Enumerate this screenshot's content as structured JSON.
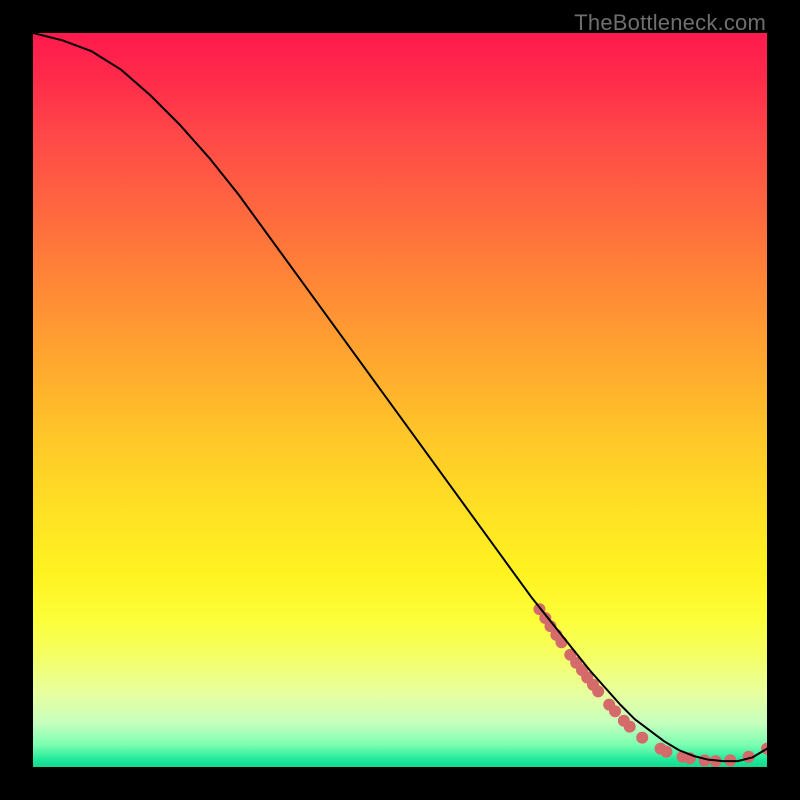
{
  "watermark": "TheBottleneck.com",
  "colors": {
    "background": "#000000",
    "curve": "#000000",
    "marker": "#d46a6a",
    "gradient_top": "#ff1a4d",
    "gradient_mid": "#fff321",
    "gradient_bottom": "#15d890"
  },
  "chart_data": {
    "type": "line",
    "title": "",
    "xlabel": "",
    "ylabel": "",
    "xlim": [
      0,
      100
    ],
    "ylim": [
      0,
      100
    ],
    "grid": false,
    "legend": false,
    "series": [
      {
        "name": "curve",
        "x": [
          0,
          4,
          8,
          12,
          16,
          20,
          24,
          28,
          32,
          36,
          40,
          44,
          48,
          52,
          56,
          60,
          64,
          68,
          72,
          76,
          80,
          82,
          84,
          86,
          88,
          90,
          92,
          94,
          96,
          98,
          100
        ],
        "y": [
          100,
          99,
          97.5,
          95,
          91.5,
          87.5,
          83,
          78,
          72.5,
          67,
          61.5,
          56,
          50.5,
          45,
          39.5,
          34,
          28.5,
          23,
          18,
          13,
          8.5,
          6.5,
          5,
          3.5,
          2.3,
          1.5,
          1,
          0.8,
          0.8,
          1.3,
          2.5
        ]
      }
    ],
    "markers": [
      {
        "x": 69.0,
        "y": 21.5
      },
      {
        "x": 69.8,
        "y": 20.3
      },
      {
        "x": 70.5,
        "y": 19.2
      },
      {
        "x": 71.3,
        "y": 18.0
      },
      {
        "x": 72.0,
        "y": 17.0
      },
      {
        "x": 73.2,
        "y": 15.3
      },
      {
        "x": 74.0,
        "y": 14.2
      },
      {
        "x": 74.8,
        "y": 13.2
      },
      {
        "x": 75.5,
        "y": 12.2
      },
      {
        "x": 76.3,
        "y": 11.2
      },
      {
        "x": 77.0,
        "y": 10.3
      },
      {
        "x": 78.5,
        "y": 8.5
      },
      {
        "x": 79.3,
        "y": 7.6
      },
      {
        "x": 80.5,
        "y": 6.3
      },
      {
        "x": 81.3,
        "y": 5.5
      },
      {
        "x": 83.0,
        "y": 4.0
      },
      {
        "x": 85.5,
        "y": 2.5
      },
      {
        "x": 86.3,
        "y": 2.1
      },
      {
        "x": 88.5,
        "y": 1.4
      },
      {
        "x": 89.5,
        "y": 1.2
      },
      {
        "x": 91.5,
        "y": 0.9
      },
      {
        "x": 93.0,
        "y": 0.8
      },
      {
        "x": 95.0,
        "y": 0.9
      },
      {
        "x": 97.5,
        "y": 1.4
      },
      {
        "x": 100.0,
        "y": 2.5
      }
    ],
    "marker_radius": 6
  }
}
